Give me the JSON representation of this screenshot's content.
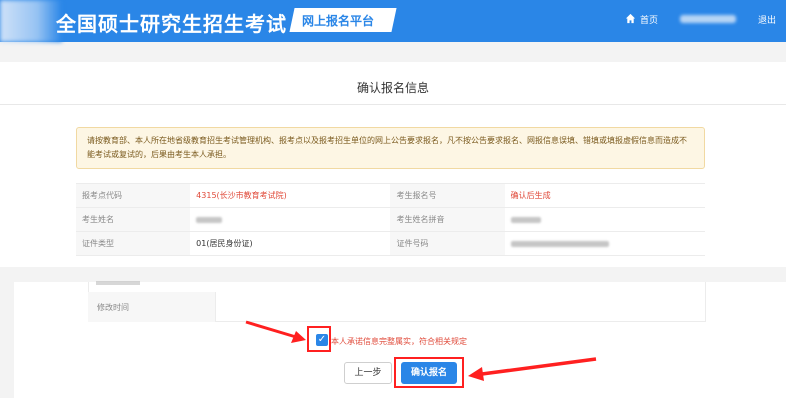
{
  "header": {
    "site_title": "全国硕士研究生招生考试",
    "platform_tag": "网上报名平台",
    "home_label": "首页",
    "logout_label": "退出"
  },
  "page": {
    "title": "确认报名信息",
    "notice": "请按教育部、本人所在地省级教育招生考试管理机构、报考点以及报考招生单位的网上公告要求报名，凡不按公告要求报名、网报信息误填、错填或填报虚假信息而造成不能考试或复试的，后果由考生本人承担。"
  },
  "info_table": {
    "rows": [
      {
        "label1": "报考点代码",
        "value1": "4315(长沙市教育考试院)",
        "label2": "考生报名号",
        "value2": "确认后生成"
      },
      {
        "label1": "考生姓名",
        "value1": "",
        "label2": "考生姓名拼音",
        "value2": ""
      },
      {
        "label1": "证件类型",
        "value1": "01(居民身份证)",
        "label2": "证件号码",
        "value2": ""
      }
    ]
  },
  "lower_table": {
    "modify_time_label": "修改时间"
  },
  "agreement": {
    "checked": true,
    "label": "本人承诺信息完整属实，符合相关规定"
  },
  "buttons": {
    "prev_label": "上一步",
    "confirm_label": "确认报名"
  },
  "colors": {
    "brand_blue": "#2a86e7",
    "highlight_red": "#ff2020",
    "warning_text": "#e04a3a"
  }
}
